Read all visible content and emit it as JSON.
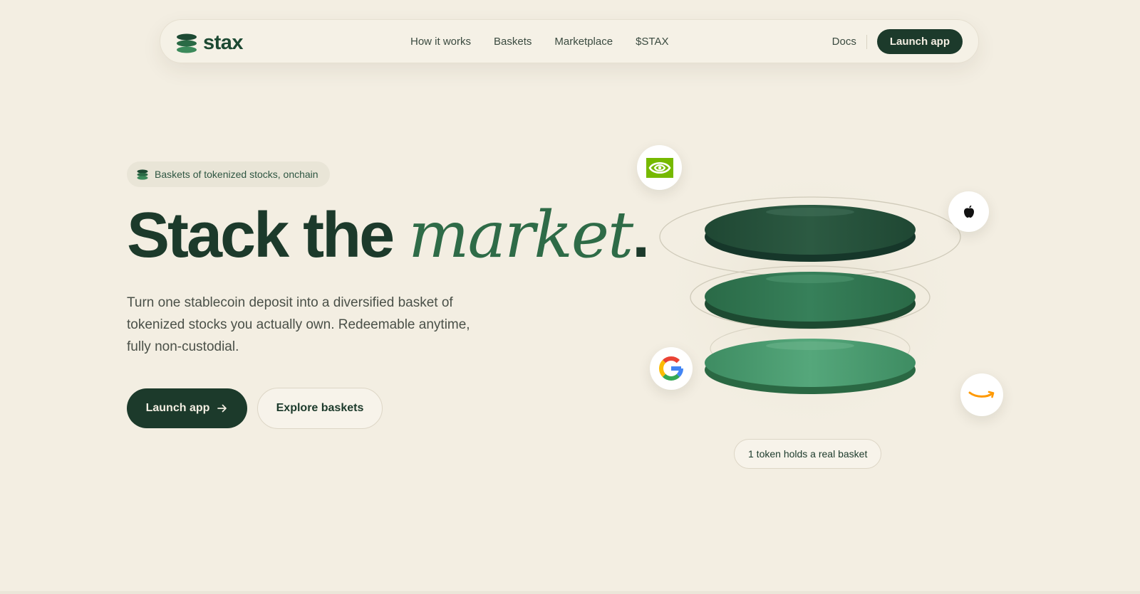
{
  "nav": {
    "brand": "stax",
    "links": [
      "How it works",
      "Baskets",
      "Marketplace",
      "$STAX"
    ],
    "docs": "Docs",
    "cta": "Launch app"
  },
  "hero": {
    "pill": "Baskets of tokenized stocks, onchain",
    "headline_part1": "Stack the ",
    "headline_italic": "market",
    "headline_end": ".",
    "subtext": "Turn one stablecoin deposit into a diversified basket of tokenized stocks you actually own. Redeemable anytime, fully non-custodial.",
    "primary_cta": "Launch app",
    "secondary_cta": "Explore baskets"
  },
  "illustration": {
    "caption": "1 token holds a real basket",
    "logos": [
      "nvidia-logo",
      "apple-logo",
      "google-logo",
      "amazon-logo"
    ]
  },
  "colors": {
    "background": "#f3eee2",
    "primary": "#1c3a2b",
    "accent": "#2e6b47"
  }
}
